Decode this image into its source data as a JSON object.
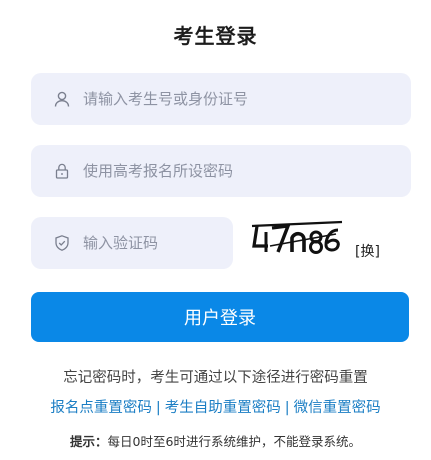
{
  "title": "考生登录",
  "fields": {
    "user_placeholder": "请输入考生号或身份证号",
    "user_value": "",
    "pass_placeholder": "使用高考报名所设密码",
    "pass_value": "",
    "code_placeholder": "输入验证码",
    "code_value": ""
  },
  "captcha": {
    "text": "47n86",
    "swap_label": "[换]"
  },
  "login_button": "用户登录",
  "forgot_text": "忘记密码时，考生可通过以下途径进行密码重置",
  "links": [
    "报名点重置密码",
    "考生自助重置密码",
    "微信重置密码"
  ],
  "link_separator": "|",
  "tip": {
    "label": "提示：",
    "text": "每日0时至6时进行系统维护，不能登录系统。"
  },
  "colors": {
    "field_bg": "#eef0fa",
    "button": "#0a88e7",
    "link": "#1b7ec4"
  },
  "icons": [
    "user-icon",
    "lock-icon",
    "shield-icon"
  ]
}
